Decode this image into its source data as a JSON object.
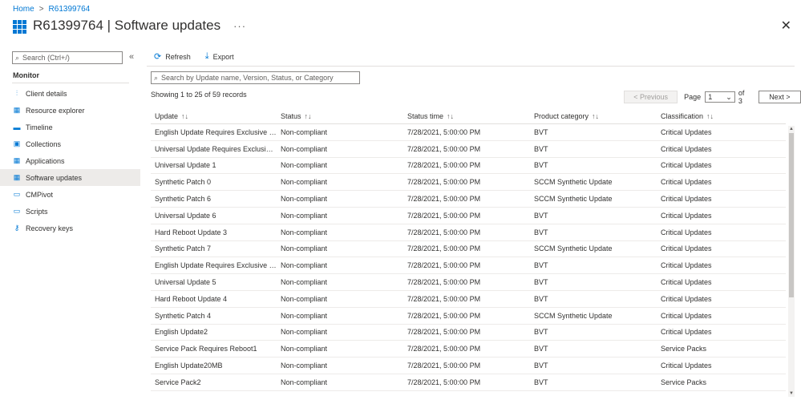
{
  "breadcrumb": {
    "home": "Home",
    "separator": ">",
    "current": "R61399764"
  },
  "header": {
    "title": "R61399764 | Software updates",
    "more": "···",
    "close": "✕"
  },
  "sidebar": {
    "search_placeholder": "Search (Ctrl+/)",
    "collapse": "«",
    "section": "Monitor",
    "items": [
      {
        "label": "Client details",
        "icon": "client-details-icon",
        "glyph": "⫶"
      },
      {
        "label": "Resource explorer",
        "icon": "resource-explorer-icon",
        "glyph": "▦"
      },
      {
        "label": "Timeline",
        "icon": "timeline-icon",
        "glyph": "▬"
      },
      {
        "label": "Collections",
        "icon": "collections-icon",
        "glyph": "▣"
      },
      {
        "label": "Applications",
        "icon": "applications-icon",
        "glyph": "▦"
      },
      {
        "label": "Software updates",
        "icon": "software-updates-icon",
        "glyph": "▦",
        "active": true
      },
      {
        "label": "CMPivot",
        "icon": "cmpivot-icon",
        "glyph": "▭"
      },
      {
        "label": "Scripts",
        "icon": "scripts-icon",
        "glyph": "▭"
      },
      {
        "label": "Recovery keys",
        "icon": "key-icon",
        "glyph": "⚷"
      }
    ]
  },
  "toolbar": {
    "refresh": "Refresh",
    "export": "Export"
  },
  "main": {
    "search_placeholder": "Search by Update name, Version, Status, or Category",
    "showing": "Showing 1 to 25 of 59 records"
  },
  "pager": {
    "previous": "< Previous",
    "page_label": "Page",
    "page_value": "1",
    "of_label": "of 3",
    "next": "Next >"
  },
  "table": {
    "columns": [
      "Update",
      "Status",
      "Status time",
      "Product category",
      "Classification"
    ],
    "sort_icons": [
      "↑↓",
      "↑↓",
      "↑↓",
      "↑↓",
      "↑↓"
    ],
    "rows": [
      [
        "English Update Requires Exclusive Han...",
        "Non-compliant",
        "7/28/2021, 5:00:00 PM",
        "BVT",
        "Critical Updates"
      ],
      [
        "Universal Update Requires Exclusive H...",
        "Non-compliant",
        "7/28/2021, 5:00:00 PM",
        "BVT",
        "Critical Updates"
      ],
      [
        "Universal Update 1",
        "Non-compliant",
        "7/28/2021, 5:00:00 PM",
        "BVT",
        "Critical Updates"
      ],
      [
        "Synthetic Patch 0",
        "Non-compliant",
        "7/28/2021, 5:00:00 PM",
        "SCCM Synthetic Update",
        "Critical Updates"
      ],
      [
        "Synthetic Patch 6",
        "Non-compliant",
        "7/28/2021, 5:00:00 PM",
        "SCCM Synthetic Update",
        "Critical Updates"
      ],
      [
        "Universal Update 6",
        "Non-compliant",
        "7/28/2021, 5:00:00 PM",
        "BVT",
        "Critical Updates"
      ],
      [
        "Hard Reboot Update 3",
        "Non-compliant",
        "7/28/2021, 5:00:00 PM",
        "BVT",
        "Critical Updates"
      ],
      [
        "Synthetic Patch 7",
        "Non-compliant",
        "7/28/2021, 5:00:00 PM",
        "SCCM Synthetic Update",
        "Critical Updates"
      ],
      [
        "English Update Requires Exclusive Han...",
        "Non-compliant",
        "7/28/2021, 5:00:00 PM",
        "BVT",
        "Critical Updates"
      ],
      [
        "Universal Update 5",
        "Non-compliant",
        "7/28/2021, 5:00:00 PM",
        "BVT",
        "Critical Updates"
      ],
      [
        "Hard Reboot Update 4",
        "Non-compliant",
        "7/28/2021, 5:00:00 PM",
        "BVT",
        "Critical Updates"
      ],
      [
        "Synthetic Patch 4",
        "Non-compliant",
        "7/28/2021, 5:00:00 PM",
        "SCCM Synthetic Update",
        "Critical Updates"
      ],
      [
        "English Update2",
        "Non-compliant",
        "7/28/2021, 5:00:00 PM",
        "BVT",
        "Critical Updates"
      ],
      [
        "Service Pack Requires Reboot1",
        "Non-compliant",
        "7/28/2021, 5:00:00 PM",
        "BVT",
        "Service Packs"
      ],
      [
        "English Update20MB",
        "Non-compliant",
        "7/28/2021, 5:00:00 PM",
        "BVT",
        "Critical Updates"
      ],
      [
        "Service Pack2",
        "Non-compliant",
        "7/28/2021, 5:00:00 PM",
        "BVT",
        "Service Packs"
      ]
    ]
  },
  "colors": {
    "accent": "#0078d4",
    "active_bg": "#edebe9",
    "text": "#323130"
  }
}
